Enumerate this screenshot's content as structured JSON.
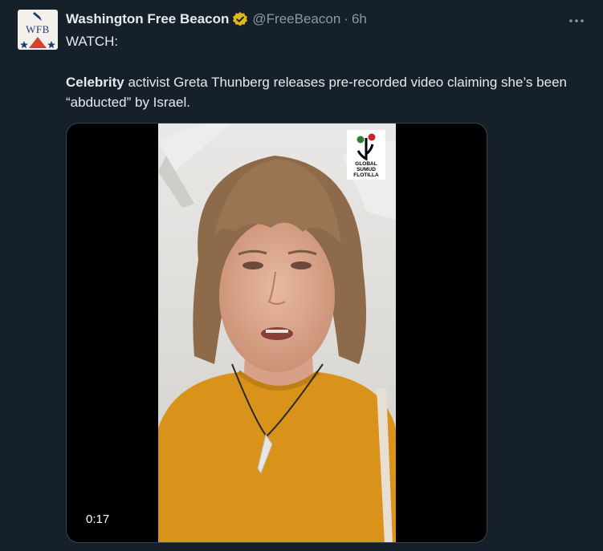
{
  "author": {
    "name": "Washington Free Beacon",
    "handle": "@FreeBeacon",
    "separator": "·",
    "time": "6h",
    "avatar_text": "WFB"
  },
  "tweet": {
    "line1": "WATCH:",
    "body_bold": "Celebrity",
    "body_rest": " activist Greta Thunberg releases pre-recorded video claiming she’s been “abducted” by Israel."
  },
  "video": {
    "duration": "0:17",
    "overlay_logo_lines": [
      "GLOBAL",
      "SUMUD",
      "FLOTILLA"
    ]
  },
  "colors": {
    "background": "#15202b",
    "text": "#e7e9ea",
    "secondary": "#8b98a5",
    "verified_gold": "#e2b719",
    "shirt": "#d9921a"
  },
  "icons": {
    "verified": "verified-gold-badge-icon",
    "more": "more-dots-icon"
  }
}
